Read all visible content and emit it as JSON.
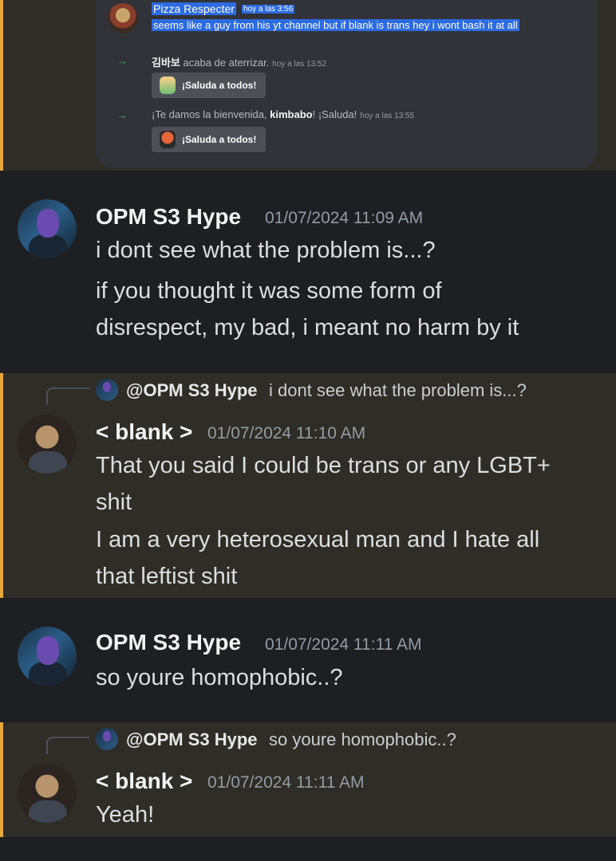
{
  "embedded": {
    "author": "Pizza Respecter",
    "time": "hoy a las 3:56",
    "text": "seems like a guy from his yt channel but if blank is trans hey i wont bash it at all",
    "join1": {
      "user": "김바보",
      "text": " acaba de aterrizar.",
      "time": "hoy a las 13:52",
      "button": "¡Saluda a todos!"
    },
    "join2": {
      "prefix": "¡Te damos la bienvenida, ",
      "user": "kimbabo",
      "suffix": "! ¡Saluda!",
      "time": "hoy a las 13:55",
      "button": "¡Saluda a todos!"
    }
  },
  "messages": [
    {
      "author": "OPM S3 Hype",
      "time": "01/07/2024 11:09 AM",
      "lines": [
        "i dont see what the problem is...?",
        "if you thought it was some form of",
        "disrespect, my bad, i meant no harm by it"
      ]
    },
    {
      "reply_to": "@OPM S3 Hype",
      "reply_text": "i dont see what the problem is...?",
      "author": "< blank >",
      "time": "01/07/2024 11:10 AM",
      "lines": [
        "That you said I could be trans or any LGBT+",
        "shit",
        "I am a very heterosexual man and I hate all",
        "that leftist shit"
      ]
    },
    {
      "author": "OPM S3 Hype",
      "time": "01/07/2024 11:11 AM",
      "lines": [
        "so youre homophobic..?"
      ]
    },
    {
      "reply_to": "@OPM S3 Hype",
      "reply_text": "so youre homophobic..?",
      "author": "< blank >",
      "time": "01/07/2024 11:11 AM",
      "lines": [
        "Yeah!"
      ]
    }
  ],
  "colors": {
    "highlight_bar": "#e7a83b",
    "selection": "#2c6be0",
    "join_arrow": "#3ba55d"
  }
}
